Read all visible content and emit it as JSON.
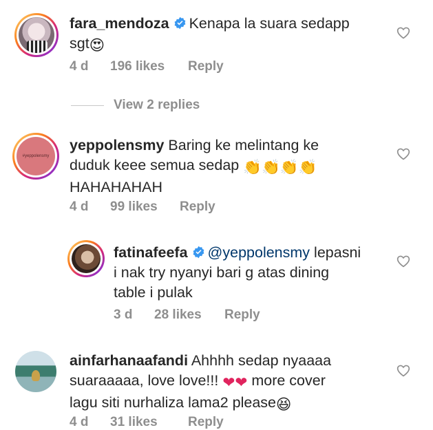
{
  "comments": [
    {
      "username": "fara_mendoza",
      "verified": true,
      "text_line1": "Kenapa la suara sedapp",
      "text_line2": "sgt",
      "emoji": "😍",
      "age": "4 d",
      "likes": "196 likes",
      "reply": "Reply"
    },
    {
      "username": "yeppolensmy",
      "verified": false,
      "avatar_label": "#yeppolensmy",
      "text_line1": "Baring ke melintang ke",
      "text_line2": "duduk keee semua sedap",
      "emoji": "👏👏👏👏",
      "text_line3": "HAHAHAHAH",
      "age": "4 d",
      "likes": "99 likes",
      "reply": "Reply"
    },
    {
      "username": "fatinafeefa",
      "verified": true,
      "mention": "@yeppolensmy",
      "text_line1": "lepasni",
      "text_line2": "i nak try nyanyi bari g atas dining",
      "text_line3": "table i pulak",
      "age": "3 d",
      "likes": "28 likes",
      "reply": "Reply"
    },
    {
      "username": "ainfarhanaafandi",
      "verified": false,
      "text_line1": "Ahhhh sedap nyaaaa",
      "text_line2a": "suaraaaaa, love love!!!",
      "hearts": "❤❤",
      "text_line2b": "more cover",
      "text_line3": "lagu siti nurhaliza lama2 please",
      "emoji": "😆",
      "age": "4 d",
      "likes": "31 likes",
      "reply": "Reply"
    }
  ],
  "view_replies": "View 2 replies",
  "colors": {
    "text": "#262626",
    "meta": "#8e8e8e",
    "mention": "#00376b",
    "verified": "#3897f0",
    "heart_emoji": "#e0245e"
  }
}
